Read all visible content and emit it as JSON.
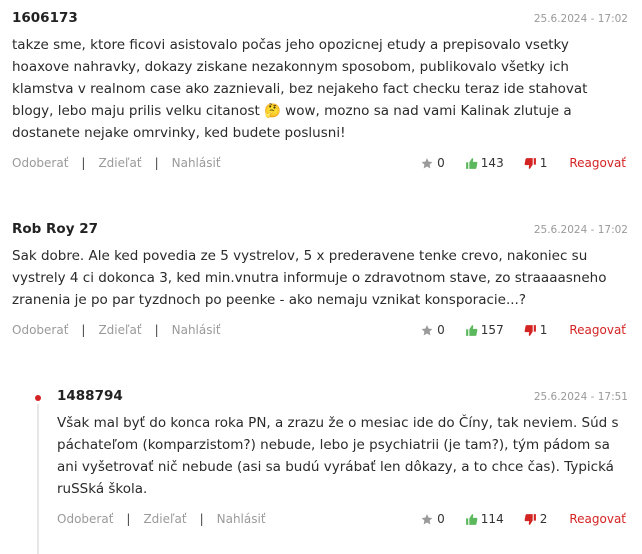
{
  "comments": [
    {
      "author": "1606173",
      "date": "25.6.2024 - 17:02",
      "text": "takze sme, ktore ficovi asistovalo počas jeho opozicnej etudy a prepisovalo vsetky hoaxove nahravky, dokazy ziskane nezakonnym sposobom, publikovalo všetky ich klamstva v realnom case ako zaznievali, bez nejakeho fact checku teraz ide stahovat blogy, lebo maju prilis velku citanost 🤔 wow, mozno sa nad vami Kalinak zlutuje a dostanete nejake omrvinky, ked budete poslusni!",
      "stars": "0",
      "likes": "143",
      "dislikes": "1"
    },
    {
      "author": "Rob Roy 27",
      "date": "25.6.2024 - 17:02",
      "text": "Sak dobre. Ale ked povedia ze 5 vystrelov, 5 x prederavene tenke crevo, nakoniec su vystrely 4 ci dokonca 3, ked min.vnutra informuje o zdravotnom stave, zo straaaasneho zranenia je po par tyzdnoch po peenke - ako nemaju vznikat konsporacie...?",
      "stars": "0",
      "likes": "157",
      "dislikes": "1"
    },
    {
      "author": "1488794",
      "date": "25.6.2024 - 17:51",
      "text": "Však mal byť do konca roka PN, a zrazu že o mesiac ide do Číny, tak neviem. Súd s páchateľom (komparzistom?) nebude, lebo je psychiatrii (je tam?), tým pádom sa ani vyšetrovať nič nebude (asi sa budú vyrábať len dôkazy, a to chce čas). Typická ruSSká škola.",
      "stars": "0",
      "likes": "114",
      "dislikes": "2"
    }
  ],
  "actions": {
    "unfollow": "Odoberať",
    "share": "Zdieľať",
    "report": "Nahlásiť",
    "separator": "|",
    "reply": "Reagovať"
  },
  "colors": {
    "accent": "#d42323",
    "like": "#5cb85c",
    "muted": "#9a9a9a"
  },
  "icons": [
    "star-icon",
    "thumbs-up-icon",
    "thumbs-down-icon"
  ]
}
